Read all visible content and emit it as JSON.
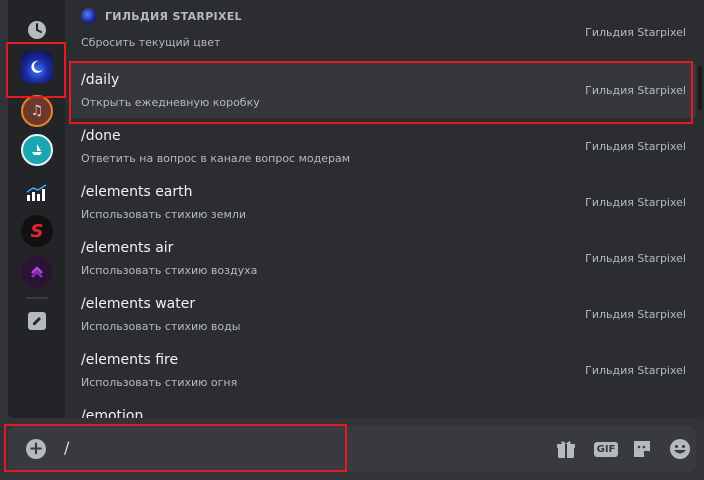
{
  "group": {
    "name": "ГИЛЬДИЯ STARPIXEL"
  },
  "commands": [
    {
      "name": "",
      "desc": "Сбросить текущий цвет",
      "source": "Гильдия Starpixel"
    },
    {
      "name": "/daily",
      "desc": "Открыть ежедневную коробку",
      "source": "Гильдия Starpixel"
    },
    {
      "name": "/done",
      "desc": "Ответить на вопрос в канале вопрос модерам",
      "source": "Гильдия Starpixel"
    },
    {
      "name": "/elements earth",
      "desc": "Использовать стихию земли",
      "source": "Гильдия Starpixel"
    },
    {
      "name": "/elements air",
      "desc": "Использовать стихию воздуха",
      "source": "Гильдия Starpixel"
    },
    {
      "name": "/elements water",
      "desc": "Использовать стихию воды",
      "source": "Гильдия Starpixel"
    },
    {
      "name": "/elements fire",
      "desc": "Использовать стихию огня",
      "source": "Гильдия Starpixel"
    },
    {
      "name": "/emotion",
      "desc": "",
      "source": ""
    }
  ],
  "input": {
    "value": "/"
  },
  "toolbar": {
    "gif_label": "GIF"
  },
  "rail": {
    "icons": [
      "clock-icon",
      "starpixel-guild-icon",
      "music-server-icon",
      "boat-server-icon",
      "stats-server-icon",
      "s-server-icon",
      "arrow-server-icon",
      "edit-icon"
    ]
  },
  "colors": {
    "highlight_border": "#e01b24",
    "selected_row": "#35373c"
  }
}
